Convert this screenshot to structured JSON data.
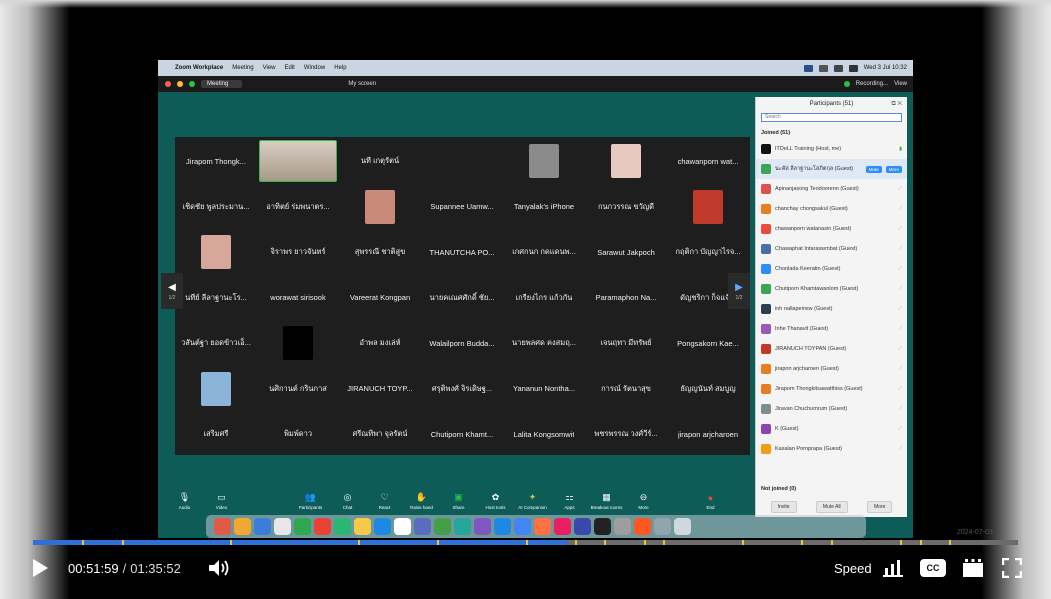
{
  "mac_menubar": {
    "app_name": "Zoom Workplace",
    "menus": [
      "Meeting",
      "View",
      "Edit",
      "Window",
      "Help"
    ],
    "clock": "Wed 3 Jul 10:32"
  },
  "zoom_titlebar": {
    "tab_label": "Meeting",
    "screen_label": "My screen",
    "recording_label": "Recording...",
    "view_label": "View"
  },
  "gallery": {
    "page_left": "1/2",
    "page_right": "1/2",
    "rows": [
      [
        "Jirapom Thongk...",
        "",
        "นที เกตุรัตน์",
        "",
        "",
        "",
        "chawanporn wat..."
      ],
      [
        "เชิดชัย พูลประมาน...",
        "อาทิตย์ ร่มพนาตร...",
        "",
        "Supannee Uamw...",
        "Tanyalak's iPhone",
        "กนกวรรณ ขวัญดี",
        ""
      ],
      [
        "",
        "จิราพร ยาวจันทร์",
        "สุพรรณี ชาติสูข",
        "THANUTCHA PO...",
        "เกศกนก กดแดนพ...",
        "Sarawut Jakpoch",
        "กฤติกา บัญญาไรจ..."
      ],
      [
        "นทีย์ ลีลาฐานะโร...",
        "worawat sirisook",
        "Vareerat Kongpan",
        "นายคเณศศักดิ์ ชัย...",
        "เกรียงไกร แก้วกัน",
        "Paramaphon Na...",
        "ดัญชริกา ก็จแจ้..."
      ],
      [
        "วสันต์ฐา ยอดข้าวเอ็...",
        "",
        "อำพล มงเล่ห์",
        "Walailporn Budda...",
        "นายพลศด คงสมฤ...",
        "เจนฤทา มีทรัพย์",
        "Pongsakorn Kae..."
      ],
      [
        "",
        "นศิกานต์ กรินกาส",
        "JIRANUCH TOYP...",
        "ศรุติพงศ์ จิรเดิษฐ...",
        "Yananun Nontha...",
        "การณ์ รัตนาสุข",
        "ธัญญนันท์ สมบูญ"
      ],
      [
        "เสริมศรี",
        "พิมพ์ดาว",
        "ศรีณทิพา จุลรัตน์",
        "Chutiporn Khamt...",
        "Lalita Kongsomwit",
        "พชรพรรณ วงศ์วีร์...",
        "jirapon arjcharoen"
      ]
    ]
  },
  "participants_panel": {
    "title": "Participants (51)",
    "search_placeholder": "Search",
    "joined_label": "Joined (51)",
    "not_joined_label": "Not joined (0)",
    "host_row": "ITDeLL Training (Host, me)",
    "rows": [
      "นะคัส ลีลาฐานะโสภิตกุล (Guest)",
      "Apinanjasong Teodoorenn (Guest)",
      "chanchay chongsakul (Guest)",
      "chawanporn watanasin (Guest)",
      "Chawaphat Intaraswmbat (Guest)",
      "Chonlada Keeratin (Guest)",
      "Chutiporn Khamtawanlom (Guest)",
      "inh nallapeinsw (Guest)",
      "Inhe Thanavit (Guest)",
      "JIRANUCH TOYPAN (Guest)",
      "jirapon arjcharoen (Guest)",
      "Jirapom Thongkitsawatthiss (Guest)",
      "Jiravan Chuchumrum (Guest)",
      "K (Guest)",
      "Kasalan Pornprapa (Guest)"
    ],
    "badge_mute": "Mute",
    "badge_more": "More",
    "foot_invite": "Invite",
    "foot_mute_all": "Mute All",
    "foot_more": "More"
  },
  "zoom_toolbar": [
    {
      "icon": "mic-icon",
      "glyph": "🎙",
      "label": "Audio"
    },
    {
      "icon": "video-icon",
      "glyph": "▭",
      "label": "Video"
    },
    {
      "icon": "participants-icon",
      "glyph": "👥",
      "label": "Participants"
    },
    {
      "icon": "chat-icon",
      "glyph": "◎",
      "label": "Chat"
    },
    {
      "icon": "react-icon",
      "glyph": "♡",
      "label": "React"
    },
    {
      "icon": "raise-hand-icon",
      "glyph": "✋",
      "label": "Raise hand"
    },
    {
      "icon": "share-icon",
      "glyph": "▣",
      "label": "Share"
    },
    {
      "icon": "host-tools-icon",
      "glyph": "✿",
      "label": "Host tools"
    },
    {
      "icon": "ai-companion-icon",
      "glyph": "✦",
      "label": "AI Companion"
    },
    {
      "icon": "apps-icon",
      "glyph": "⚏",
      "label": "Apps"
    },
    {
      "icon": "breakout-icon",
      "glyph": "▦",
      "label": "Breakout rooms"
    },
    {
      "icon": "more-icon",
      "glyph": "⊖",
      "label": "More"
    },
    {
      "icon": "end-icon",
      "glyph": "●",
      "label": "End"
    }
  ],
  "player": {
    "current_time": "00:51:59",
    "separator": "/",
    "duration": "01:35:52",
    "played_fraction": 0.542,
    "buffered_fraction": 1.0,
    "speed_label": "Speed",
    "cc_label": "CC",
    "ghost_timestamp": "2024-07-03",
    "colors": {
      "played": "#2f6fd8",
      "marker": "#e7c73b"
    }
  }
}
